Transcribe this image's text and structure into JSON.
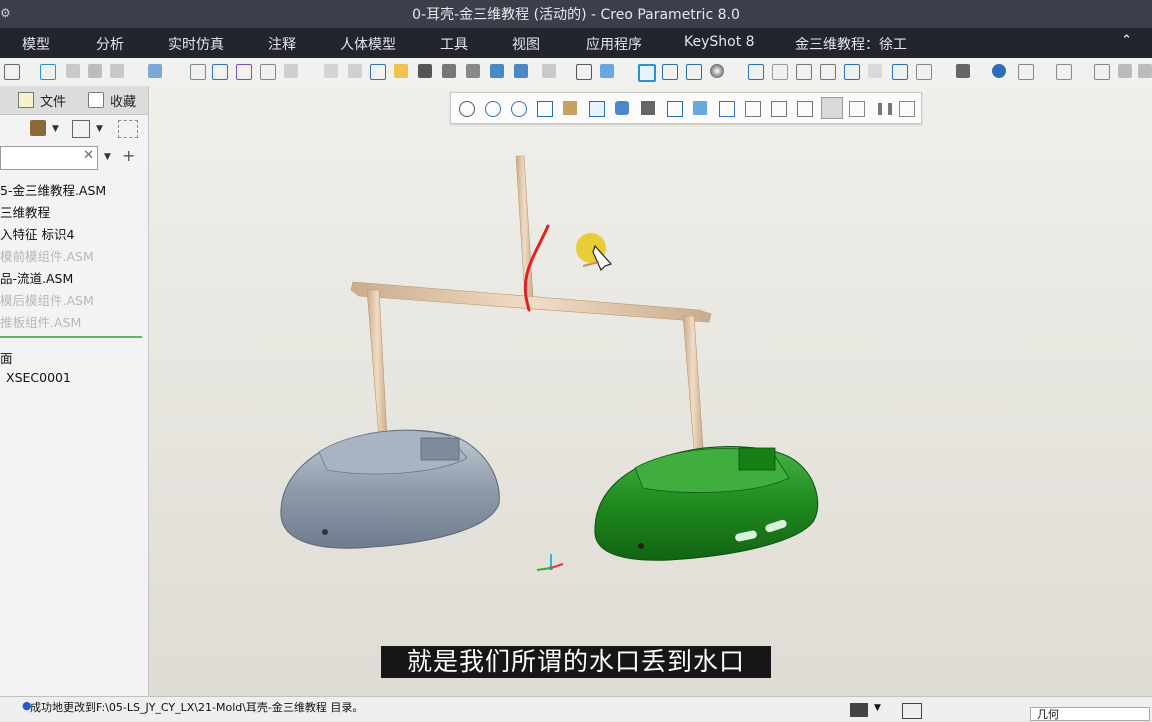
{
  "window": {
    "title": "0-耳壳-金三维教程 (活动的) - Creo Parametric 8.0"
  },
  "menu": [
    {
      "label": "模型"
    },
    {
      "label": "分析"
    },
    {
      "label": "实时仿真"
    },
    {
      "label": "注释"
    },
    {
      "label": "人体模型"
    },
    {
      "label": "工具"
    },
    {
      "label": "视图"
    },
    {
      "label": "应用程序"
    },
    {
      "label": "KeyShot 8"
    },
    {
      "label": "金三维教程：徐工"
    }
  ],
  "sidebar": {
    "tabs": [
      {
        "label": "文件"
      },
      {
        "label": "收藏"
      }
    ],
    "search_placeholder": "",
    "tree": [
      {
        "label": "5-金三维教程.ASM",
        "dim": false
      },
      {
        "label": "三维教程",
        "dim": false
      },
      {
        "label": "入特征 标识4",
        "dim": false
      },
      {
        "label": "模前模组件.ASM",
        "dim": true
      },
      {
        "label": "品-流道.ASM",
        "dim": false
      },
      {
        "label": "模后模组件.ASM",
        "dim": true
      },
      {
        "label": "推板组件.ASM",
        "dim": true
      }
    ],
    "sections": [
      {
        "label": "面"
      },
      {
        "label": "XSEC0001"
      }
    ]
  },
  "subtitle": "就是我们所谓的水口丢到水口",
  "status": {
    "message": "成功地更改到F:\\05-LS_JY_CY_LX\\21-Mold\\耳壳-金三维教程 目录。",
    "filter_label": "几何"
  },
  "colors": {
    "part_left": "#8e9bab",
    "part_right": "#1f8a1f",
    "runner": "#e8cdb0",
    "sketch": "#e22222",
    "accent": "#5fb55f"
  }
}
